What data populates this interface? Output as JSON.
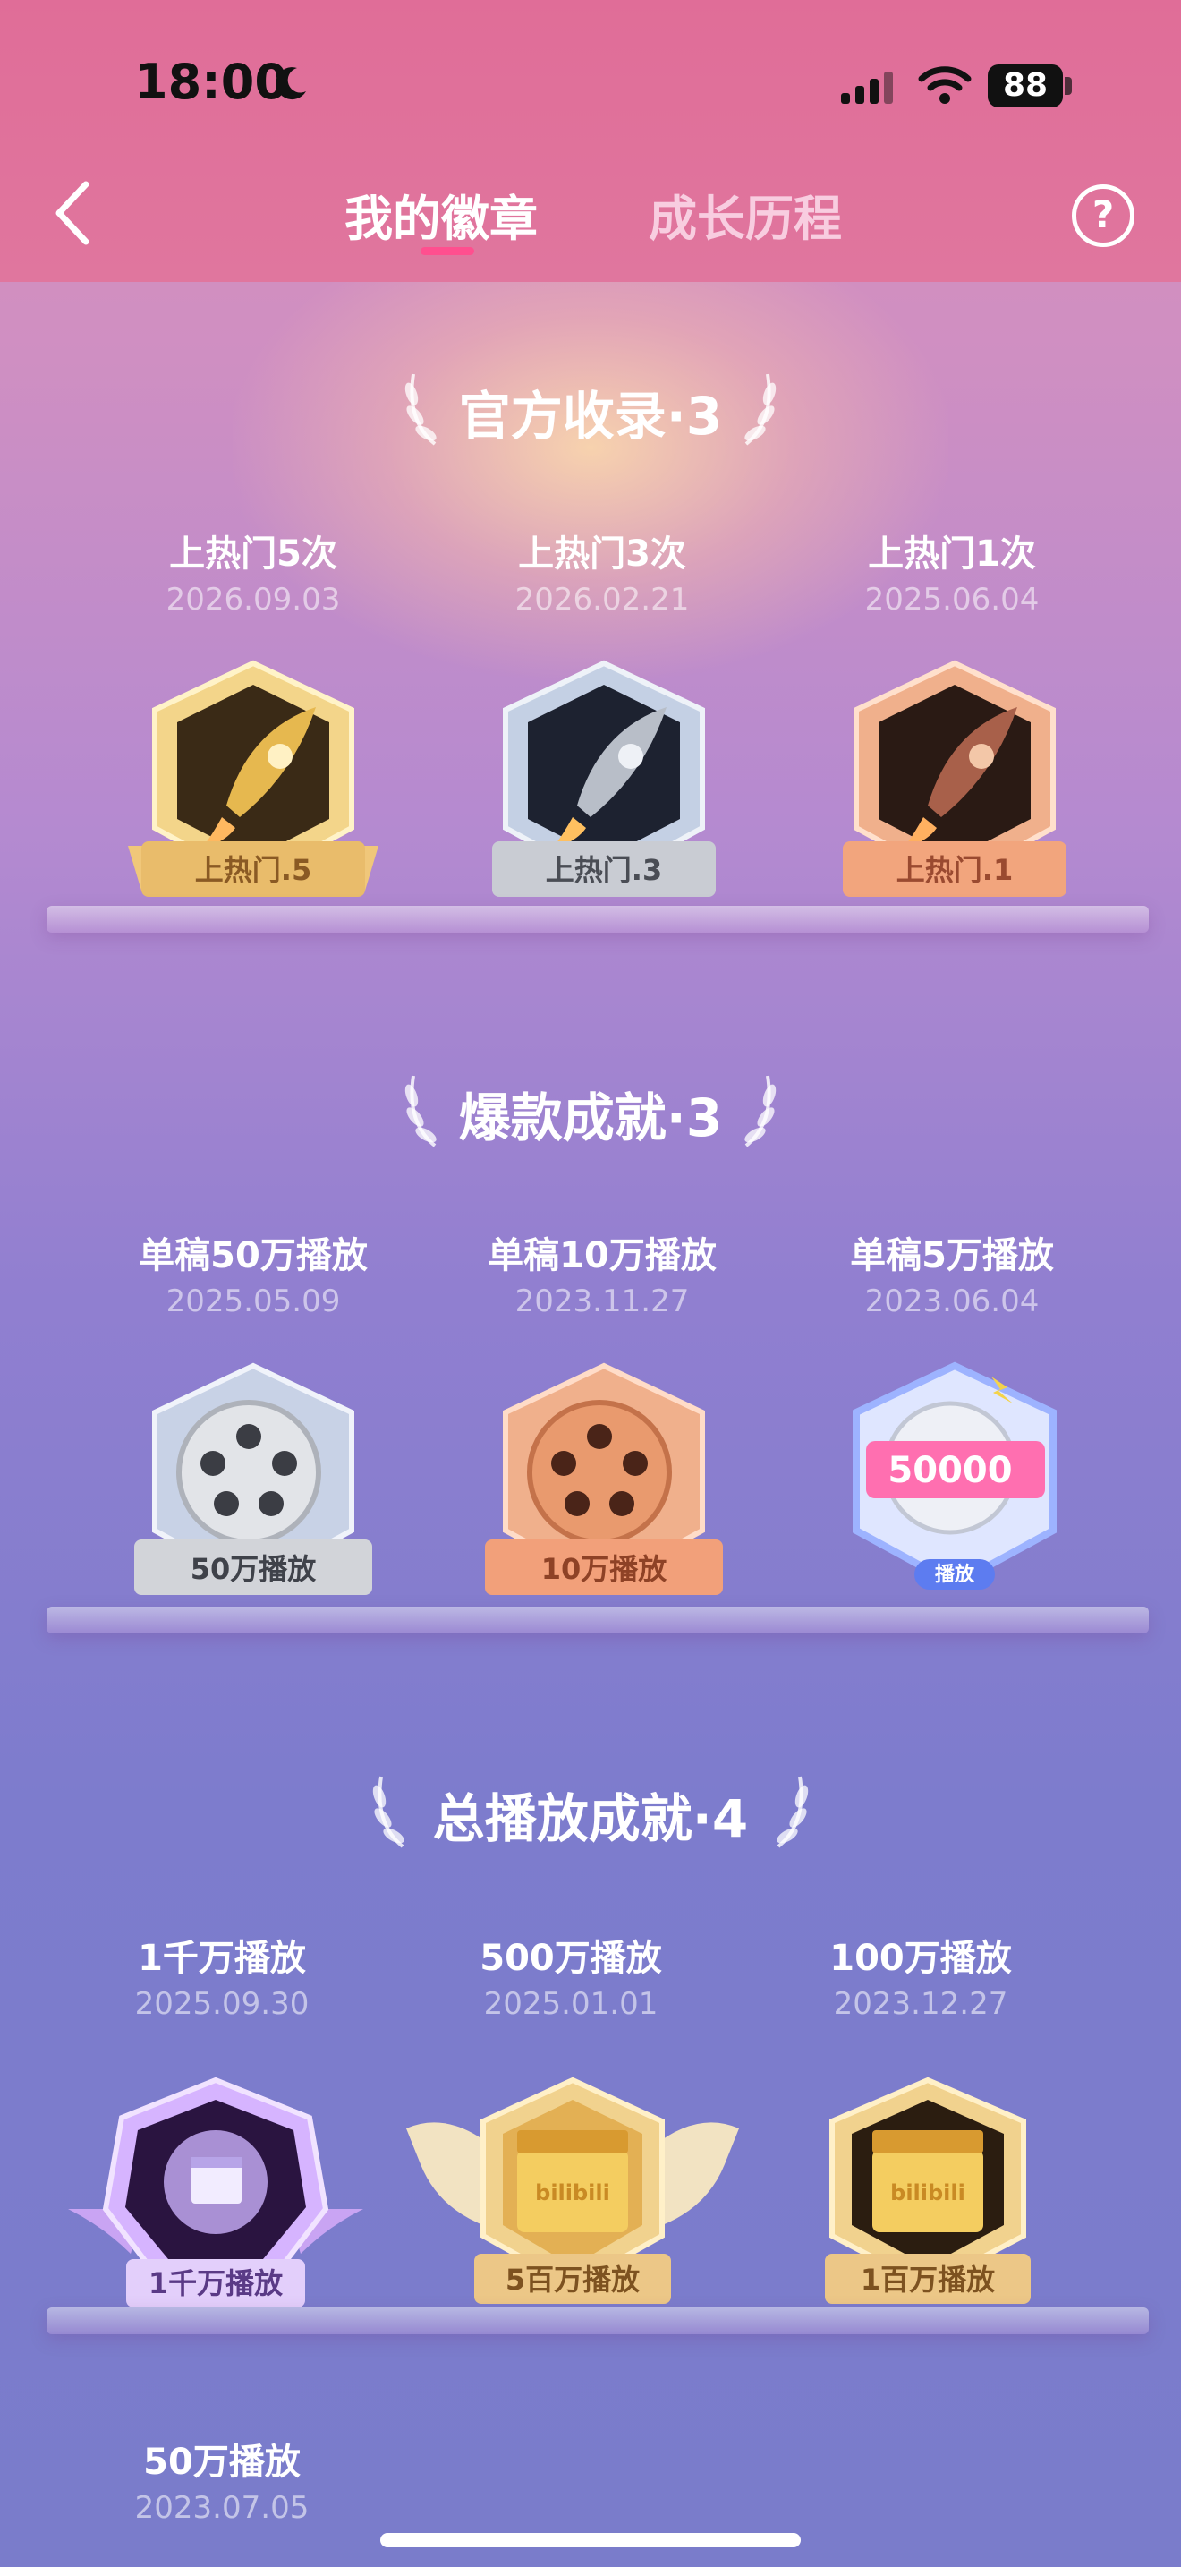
{
  "status_bar": {
    "time": "18:00",
    "battery": "88"
  },
  "header": {
    "tabs": [
      {
        "label": "我的徽章",
        "active": true
      },
      {
        "label": "成长历程",
        "active": false
      }
    ],
    "help_symbol": "?"
  },
  "sections": [
    {
      "title": "官方收录·3",
      "badges": [
        {
          "name": "上热门5次",
          "date": "2026.09.03",
          "ribbon": "上热门.5",
          "tier": "gold",
          "icon": "rocket-icon"
        },
        {
          "name": "上热门3次",
          "date": "2026.02.21",
          "ribbon": "上热门.3",
          "tier": "silver",
          "icon": "rocket-icon"
        },
        {
          "name": "上热门1次",
          "date": "2025.06.04",
          "ribbon": "上热门.1",
          "tier": "bronze",
          "icon": "rocket-icon"
        }
      ]
    },
    {
      "title": "爆款成就·3",
      "badges": [
        {
          "name": "单稿50万播放",
          "date": "2025.05.09",
          "ribbon": "50万播放",
          "tier": "silver",
          "icon": "film-reel-icon"
        },
        {
          "name": "单稿10万播放",
          "date": "2023.11.27",
          "ribbon": "10万播放",
          "tier": "bronze",
          "icon": "film-reel-icon"
        },
        {
          "name": "单稿5万播放",
          "date": "2023.06.04",
          "ribbon": "播放",
          "count": "50000",
          "tier": "pink",
          "icon": "film-reel-icon"
        }
      ]
    },
    {
      "title": "总播放成就·4",
      "badges": [
        {
          "name": "1千万播放",
          "date": "2025.09.30",
          "ribbon": "1千万播放",
          "tier": "purple",
          "icon": "clapperboard-icon"
        },
        {
          "name": "500万播放",
          "date": "2025.01.01",
          "ribbon": "5百万播放",
          "tier": "gold-wing",
          "icon": "clapperboard-icon"
        },
        {
          "name": "100万播放",
          "date": "2023.12.27",
          "ribbon": "1百万播放",
          "tier": "gold",
          "icon": "clapperboard-icon"
        },
        {
          "name": "50万播放",
          "date": "2023.07.05"
        }
      ]
    }
  ],
  "colors": {
    "header_bg": "#e06d98",
    "active_underline": "#ff4f8f",
    "gold": "#e8c06a",
    "silver": "#c9cdd6",
    "bronze": "#e8a07a",
    "pink": "#ff6fb0",
    "purple": "#b48be8"
  }
}
